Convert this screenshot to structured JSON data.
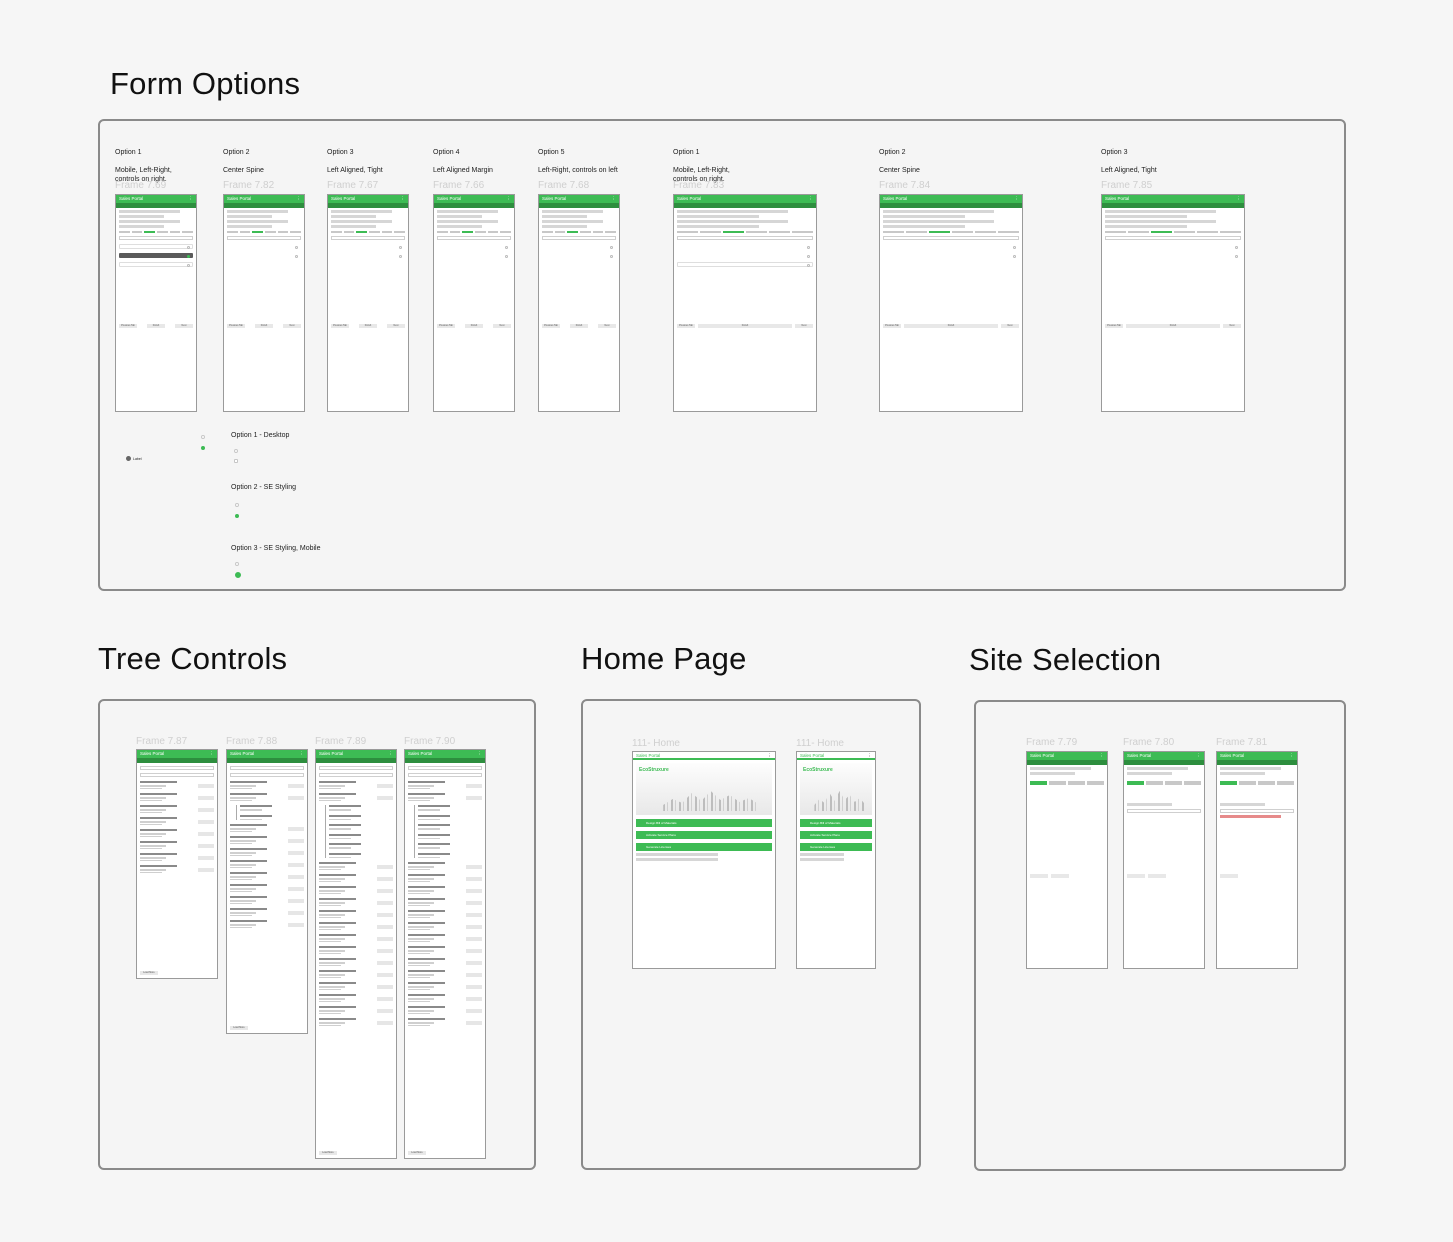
{
  "sections": {
    "form_options": "Form Options",
    "tree_controls": "Tree Controls",
    "home_page": "Home Page",
    "site_selection": "Site Selection"
  },
  "form_frames": [
    {
      "option": "Option 1",
      "desc": "Mobile, Left-Right, controls on right.",
      "frame": "Frame 7.69"
    },
    {
      "option": "Option 2",
      "desc": "Center Spine",
      "frame": "Frame 7.82"
    },
    {
      "option": "Option 3",
      "desc": "Left Aligned, Tight",
      "frame": "Frame 7.67"
    },
    {
      "option": "Option 4",
      "desc": "Left Aligned Margin",
      "frame": "Frame 7.66"
    },
    {
      "option": "Option 5",
      "desc": "Left-Right, controls on left",
      "frame": "Frame 7.68"
    },
    {
      "option": "Option 1",
      "desc": "Mobile, Left-Right, controls on right.",
      "frame": "Frame 7.83"
    },
    {
      "option": "Option 2",
      "desc": "Center Spine",
      "frame": "Frame 7.84"
    },
    {
      "option": "Option 3",
      "desc": "Left Aligned, Tight",
      "frame": "Frame 7.85"
    }
  ],
  "phone": {
    "app_title": "Sales Portal",
    "menu_glyph": "⋮",
    "footer_prev": "Previous Tab",
    "footer_finish": "Finish",
    "footer_next": "Next",
    "load_more": "Load More"
  },
  "controls_options": {
    "desktop": "Option 1 - Desktop",
    "se_styling": "Option 2 - SE Styling",
    "se_mobile": "Option 3 - SE Styling, Mobile",
    "label_text": "Label"
  },
  "tree_frames": [
    "Frame 7.87",
    "Frame 7.88",
    "Frame 7.89",
    "Frame 7.90"
  ],
  "home_frames": [
    "111- Home",
    "111- Home"
  ],
  "home": {
    "logo": "EcoStruxure",
    "btn1": "Design Bill of Materials",
    "btn2": "Activate Service Plans",
    "btn3": "Generate Licenses"
  },
  "site_frames": [
    "Frame 7.79",
    "Frame 7.80",
    "Frame 7.81"
  ]
}
